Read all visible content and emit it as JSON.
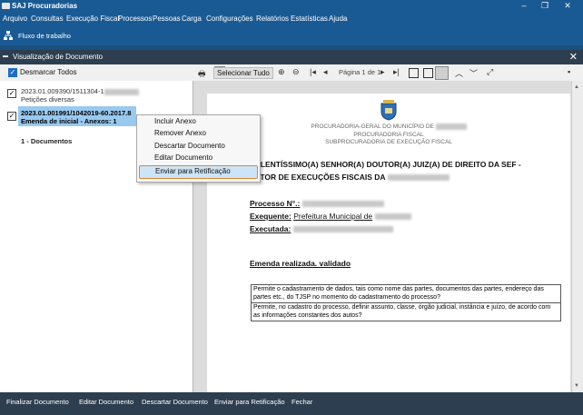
{
  "app": {
    "title": "SAJ Procuradorias"
  },
  "menu": [
    "Arquivo",
    "Consultas",
    "Execução Fiscal",
    "Processos",
    "Pessoas",
    "Carga",
    "Configurações",
    "Relatórios",
    "Estatísticas",
    "Ajuda"
  ],
  "toolbar": {
    "workflow_label": "Fluxo de trabalho"
  },
  "dialog": {
    "title": "Visualização de Documento",
    "deselect_all": "Desmarcar Todos",
    "select_all": "Selecionar Tudo",
    "page_indicator": "Página 1 de 1"
  },
  "tree": {
    "item1": {
      "line1": "2023.01.009390/1511304-1",
      "line2": "Petições diversas"
    },
    "item2": {
      "line1": "2023.01.001991/1042019-60.2017.8",
      "line2": "Emenda de inicial - Anexos: 1"
    },
    "group": "1 - Documentos"
  },
  "context_menu": {
    "items": [
      "Incluir Anexo",
      "Remover Anexo",
      "Descartar Documento",
      "Editar Documento",
      "Enviar para Retificação"
    ]
  },
  "document": {
    "header1": "PROCURADORIA-GERAL DO MUNICÍPIO DE",
    "header2": "PROCURADORIA FISCAL",
    "header3": "SUBPROCURADORIA DE EXECUÇÃO FISCAL",
    "address1": "CELENTÍSSIMO(A) SENHOR(A) DOUTOR(A) JUIZ(A) DE DIREITO DA SEF -",
    "address2": "SETOR DE EXECUÇÕES FISCAIS DA",
    "processo_label": "Processo N°.:",
    "exequente_label": "Exequente:",
    "exequente_value": "Prefeitura Municipal de",
    "executada_label": "Executada:",
    "emenda": "Emenda realizada. validado",
    "table_row1": "Permite o cadastramento de dados, tais como nome das partes, documentos das partes, endereço das partes etc., do TJSP no momento do cadastramento do processo?",
    "table_row2": "Permite, no cadastro do processo, definir assunto, classe, órgão judicial, instância e juízo, de acordo com as informações constantes dos autos?"
  },
  "bottom": [
    "Finalizar Documento",
    "Editar Documento",
    "Descartar Documento",
    "Enviar para Retificação",
    "Fechar"
  ],
  "colors": {
    "title_bar": "#1a5a94",
    "dialog_title": "#2d3e50",
    "selection": "#99c9ef",
    "highlight_border": "#e0872b"
  }
}
